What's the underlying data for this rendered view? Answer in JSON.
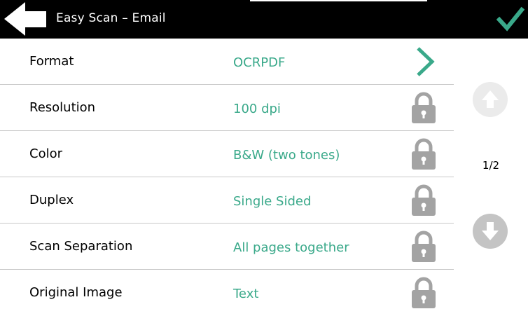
{
  "header": {
    "title": "Easy Scan – Email",
    "back_icon": "arrow-left-icon",
    "confirm_icon": "checkmark-icon",
    "accent_color": "#3aa98a"
  },
  "settings": [
    {
      "label": "Format",
      "value": "OCRPDF",
      "icon": "chevron-right-icon"
    },
    {
      "label": "Resolution",
      "value": "100 dpi",
      "icon": "lock-icon"
    },
    {
      "label": "Color",
      "value": "B&W (two tones)",
      "icon": "lock-icon"
    },
    {
      "label": "Duplex",
      "value": "Single Sided",
      "icon": "lock-icon"
    },
    {
      "label": "Scan Separation",
      "value": "All pages together",
      "icon": "lock-icon"
    },
    {
      "label": "Original Image",
      "value": "Text",
      "icon": "lock-icon"
    }
  ],
  "pagination": {
    "page_text": "1/2",
    "current_page": 1,
    "total_pages": 2,
    "up_icon": "arrow-up-icon",
    "down_icon": "arrow-down-icon"
  }
}
